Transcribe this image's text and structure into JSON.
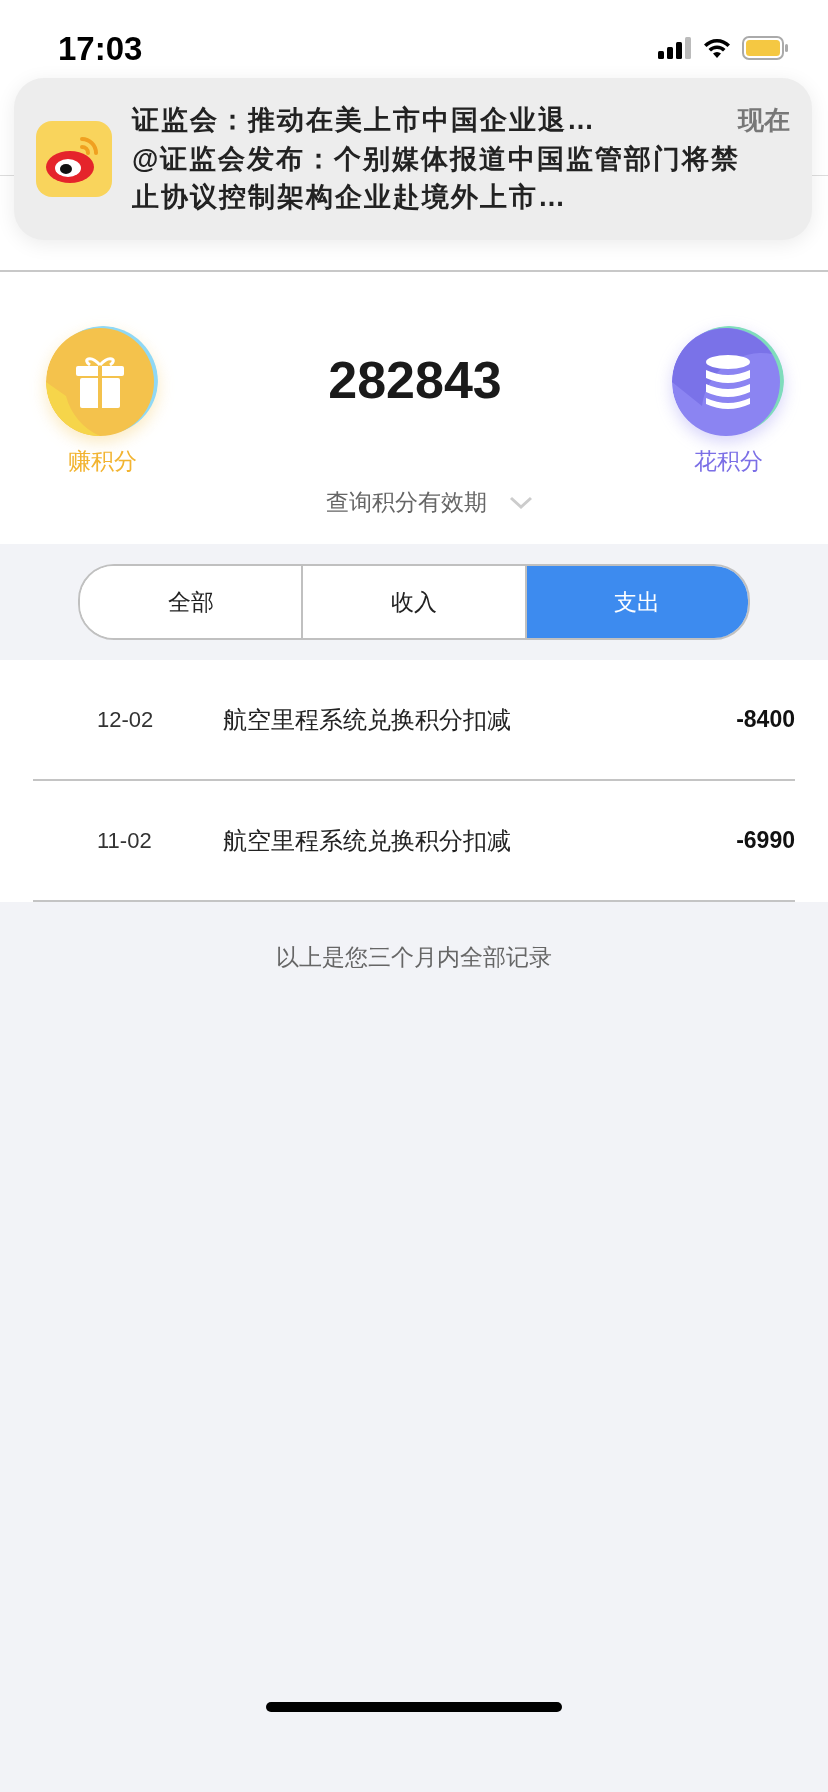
{
  "status_bar": {
    "time": "17:03"
  },
  "notification": {
    "title": "证监会：推动在美上市中国企业退…",
    "time": "现在",
    "body": "@证监会发布：个别媒体报道中国监管部门将禁止协议控制架构企业赴境外上市…"
  },
  "points": {
    "total": "282843",
    "earn_label": "赚积分",
    "spend_label": "花积分",
    "expiry_link": "查询积分有效期"
  },
  "tabs": [
    {
      "label": "全部",
      "selected": false
    },
    {
      "label": "收入",
      "selected": false
    },
    {
      "label": "支出",
      "selected": true
    }
  ],
  "records": [
    {
      "date": "12-02",
      "description": "航空里程系统兑换积分扣减",
      "amount": "-8400"
    },
    {
      "date": "11-02",
      "description": "航空里程系统兑换积分扣减",
      "amount": "-6990"
    }
  ],
  "footer_note": "以上是您三个月内全部记录"
}
